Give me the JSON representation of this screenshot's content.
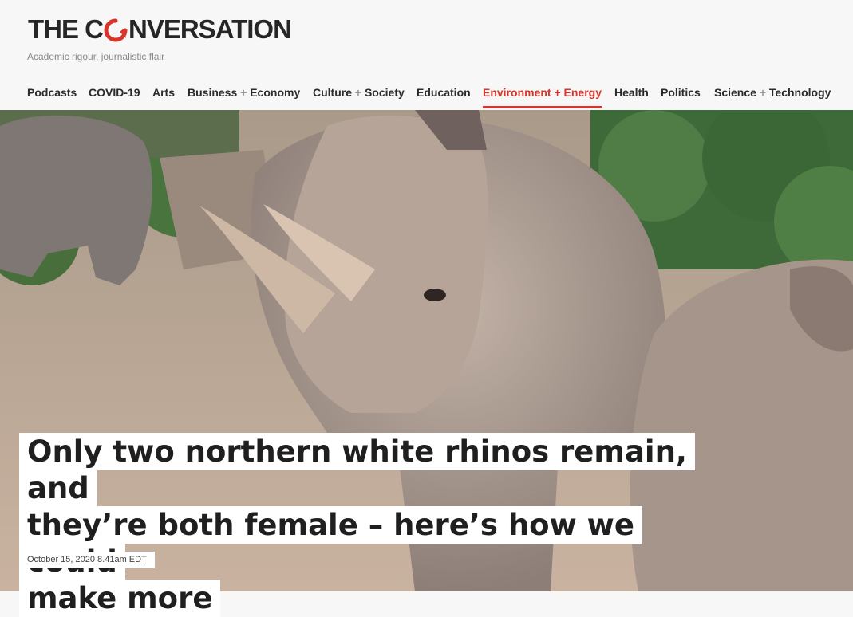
{
  "site": {
    "logo_before": "THE C",
    "logo_after": "NVERSATION",
    "tagline": "Academic rigour, journalistic flair",
    "brand_color": "#d8352a"
  },
  "nav": {
    "items": [
      {
        "label": "Podcasts"
      },
      {
        "label": "COVID-19"
      },
      {
        "label": "Arts"
      },
      {
        "label_a": "Business",
        "plus": "+",
        "label_b": "Economy"
      },
      {
        "label_a": "Culture",
        "plus": "+",
        "label_b": "Society"
      },
      {
        "label": "Education"
      },
      {
        "label_a": "Environment",
        "plus": "+",
        "label_b": "Energy",
        "active": true
      },
      {
        "label": "Health"
      },
      {
        "label": "Politics"
      },
      {
        "label_a": "Science",
        "plus": "+",
        "label_b": "Technology"
      }
    ]
  },
  "article": {
    "headline_line1": "Only two northern white rhinos remain, and",
    "headline_line2": "they’re both female – here’s how we could",
    "headline_line3": "make more",
    "date": "October 15, 2020 8.41am EDT"
  }
}
